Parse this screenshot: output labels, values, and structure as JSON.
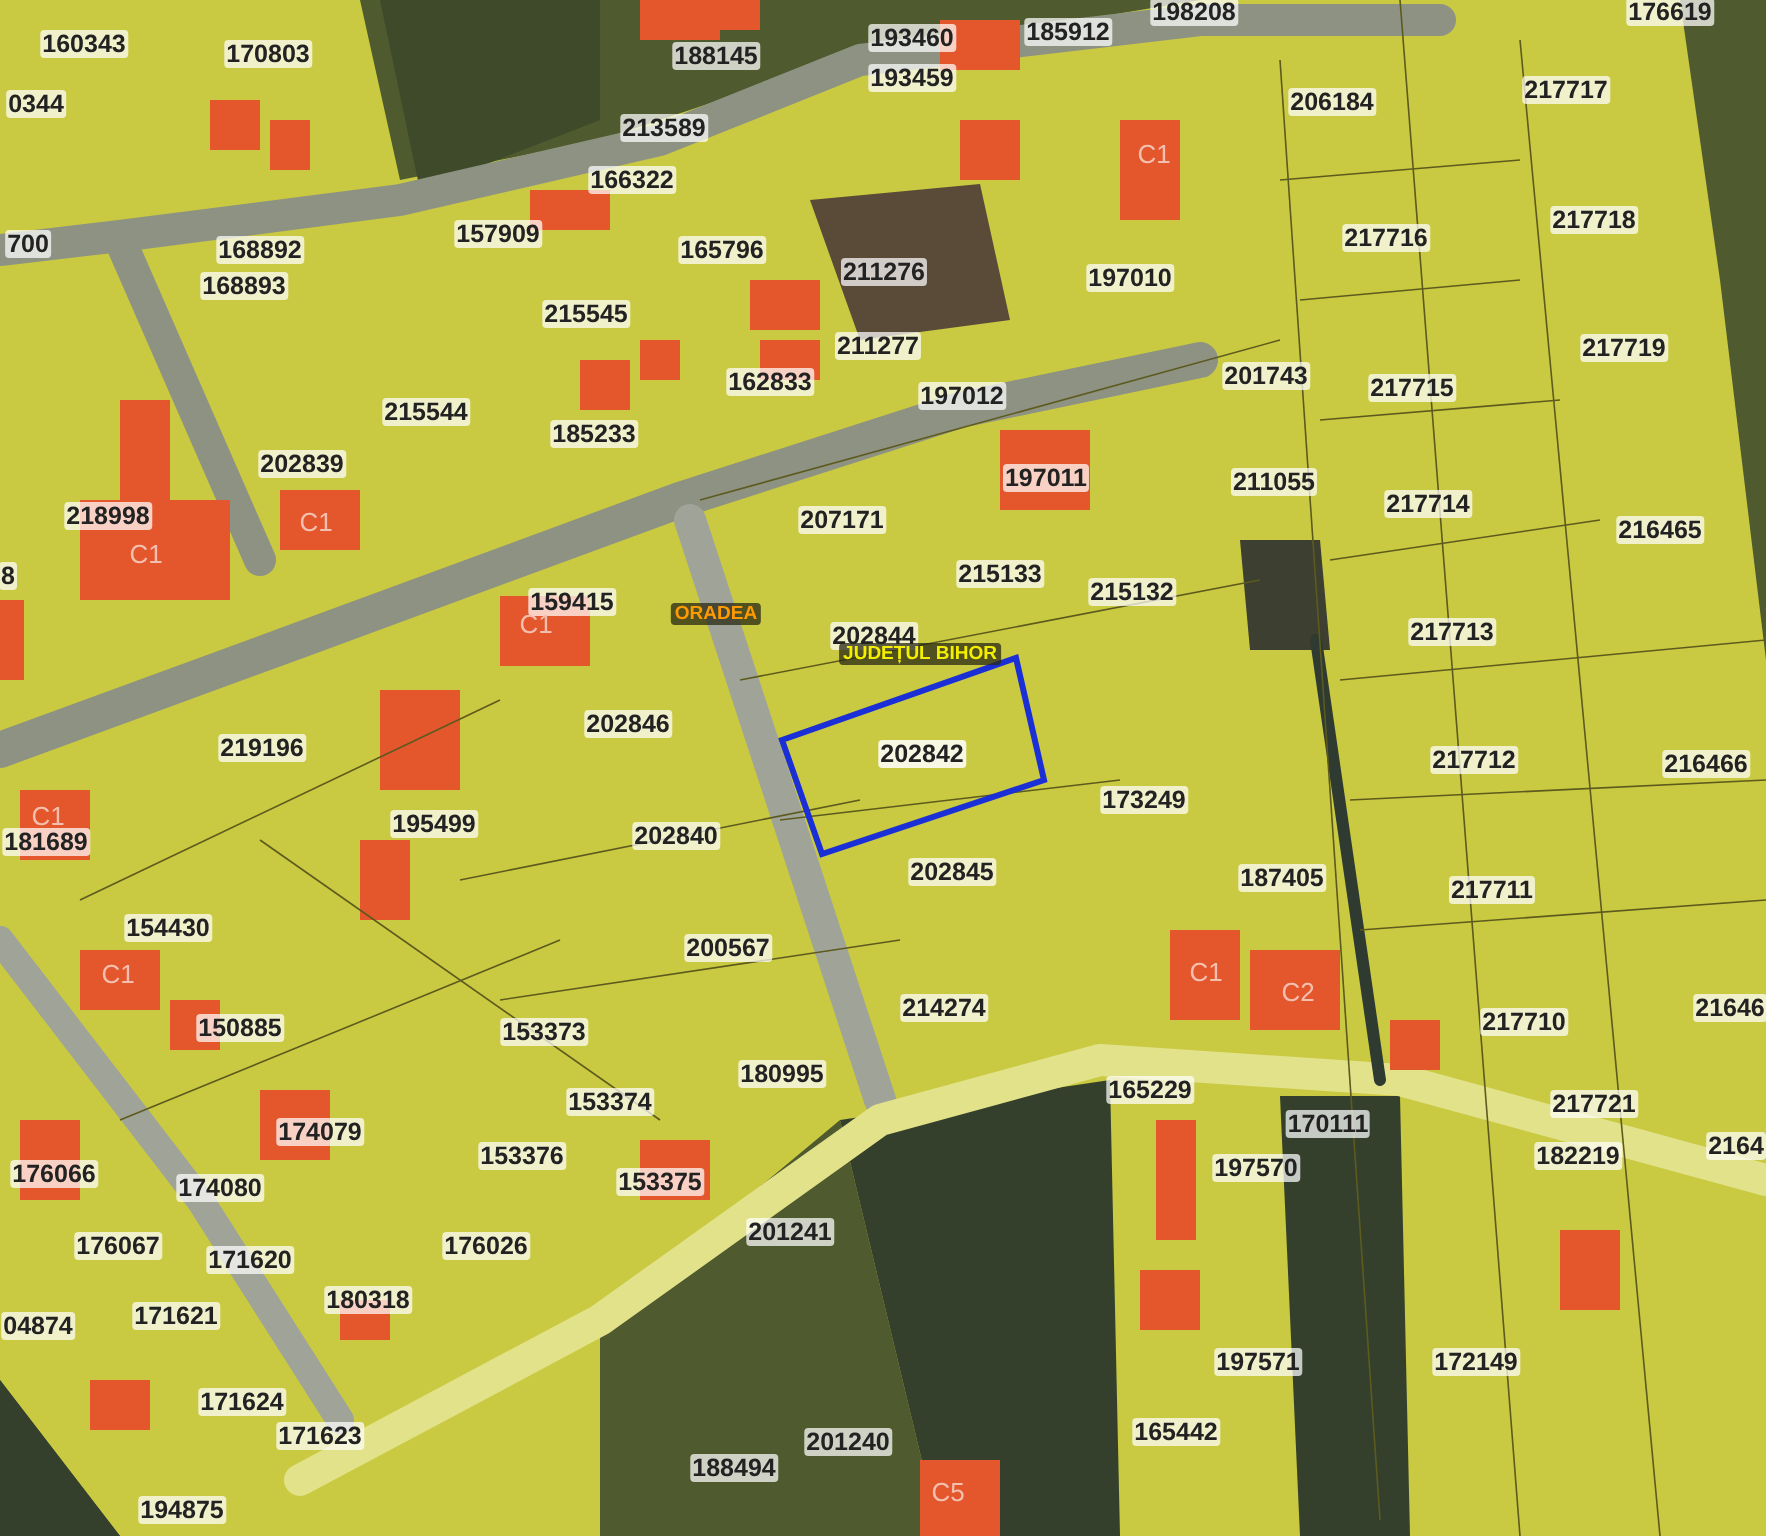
{
  "parcels": [
    {
      "label": "160343",
      "selected": false
    },
    {
      "label": "170803",
      "selected": false
    },
    {
      "label": "188145",
      "selected": false
    },
    {
      "label": "193460",
      "selected": false
    },
    {
      "label": "185912",
      "selected": false
    },
    {
      "label": "198208",
      "selected": false
    },
    {
      "label": "176619",
      "selected": false
    },
    {
      "label": "0344",
      "selected": false
    },
    {
      "label": "193459",
      "selected": false
    },
    {
      "label": "213589",
      "selected": false
    },
    {
      "label": "206184",
      "selected": false
    },
    {
      "label": "217717",
      "selected": false
    },
    {
      "label": "166322",
      "selected": false
    },
    {
      "label": "700",
      "selected": false
    },
    {
      "label": "168892",
      "selected": false
    },
    {
      "label": "157909",
      "selected": false
    },
    {
      "label": "165796",
      "selected": false
    },
    {
      "label": "217716",
      "selected": false
    },
    {
      "label": "217718",
      "selected": false
    },
    {
      "label": "168893",
      "selected": false
    },
    {
      "label": "211276",
      "selected": false
    },
    {
      "label": "197010",
      "selected": false
    },
    {
      "label": "215545",
      "selected": false
    },
    {
      "label": "211277",
      "selected": false
    },
    {
      "label": "162833",
      "selected": false
    },
    {
      "label": "201743",
      "selected": false
    },
    {
      "label": "217715",
      "selected": false
    },
    {
      "label": "217719",
      "selected": false
    },
    {
      "label": "215544",
      "selected": false
    },
    {
      "label": "185233",
      "selected": false
    },
    {
      "label": "197012",
      "selected": false
    },
    {
      "label": "197011",
      "selected": false
    },
    {
      "label": "211055",
      "selected": false
    },
    {
      "label": "217714",
      "selected": false
    },
    {
      "label": "216465",
      "selected": false
    },
    {
      "label": "202839",
      "selected": false
    },
    {
      "label": "218998",
      "selected": false
    },
    {
      "label": "207171",
      "selected": false
    },
    {
      "label": "215133",
      "selected": false
    },
    {
      "label": "215132",
      "selected": false
    },
    {
      "label": "159415",
      "selected": false
    },
    {
      "label": "8",
      "selected": false
    },
    {
      "label": "202844",
      "selected": false
    },
    {
      "label": "217713",
      "selected": false
    },
    {
      "label": "202846",
      "selected": false
    },
    {
      "label": "219196",
      "selected": false
    },
    {
      "label": "202842",
      "selected": true
    },
    {
      "label": "173249",
      "selected": false
    },
    {
      "label": "217712",
      "selected": false
    },
    {
      "label": "216466",
      "selected": false
    },
    {
      "label": "181689",
      "selected": false
    },
    {
      "label": "195499",
      "selected": false
    },
    {
      "label": "202840",
      "selected": false
    },
    {
      "label": "202845",
      "selected": false
    },
    {
      "label": "187405",
      "selected": false
    },
    {
      "label": "217711",
      "selected": false
    },
    {
      "label": "154430",
      "selected": false
    },
    {
      "label": "200567",
      "selected": false
    },
    {
      "label": "217710",
      "selected": false
    },
    {
      "label": "21646",
      "selected": false
    },
    {
      "label": "150885",
      "selected": false
    },
    {
      "label": "153373",
      "selected": false
    },
    {
      "label": "214274",
      "selected": false
    },
    {
      "label": "180995",
      "selected": false
    },
    {
      "label": "165229",
      "selected": false
    },
    {
      "label": "217721",
      "selected": false
    },
    {
      "label": "170111",
      "selected": false
    },
    {
      "label": "182219",
      "selected": false
    },
    {
      "label": "2164",
      "selected": false
    },
    {
      "label": "174079",
      "selected": false
    },
    {
      "label": "153376",
      "selected": false
    },
    {
      "label": "153374",
      "selected": false
    },
    {
      "label": "176066",
      "selected": false
    },
    {
      "label": "174080",
      "selected": false
    },
    {
      "label": "197570",
      "selected": false
    },
    {
      "label": "153375",
      "selected": false
    },
    {
      "label": "201241",
      "selected": false
    },
    {
      "label": "176026",
      "selected": false
    },
    {
      "label": "176067",
      "selected": false
    },
    {
      "label": "171620",
      "selected": false
    },
    {
      "label": "180318",
      "selected": false
    },
    {
      "label": "04874",
      "selected": false
    },
    {
      "label": "171621",
      "selected": false
    },
    {
      "label": "171624",
      "selected": false
    },
    {
      "label": "171623",
      "selected": false
    },
    {
      "label": "172149",
      "selected": false
    },
    {
      "label": "197571",
      "selected": false
    },
    {
      "label": "165442",
      "selected": false
    },
    {
      "label": "194875",
      "selected": false
    },
    {
      "label": "188494",
      "selected": false
    },
    {
      "label": "201240",
      "selected": false
    }
  ],
  "building_labels": [
    "C1",
    "C1",
    "C1",
    "C1",
    "C1",
    "C1",
    "C1",
    "C2",
    "C5"
  ],
  "place_labels": [
    {
      "kind": "city",
      "label": "ORADEA"
    },
    {
      "kind": "county",
      "label": "JUDEȚUL BIHOR"
    }
  ]
}
